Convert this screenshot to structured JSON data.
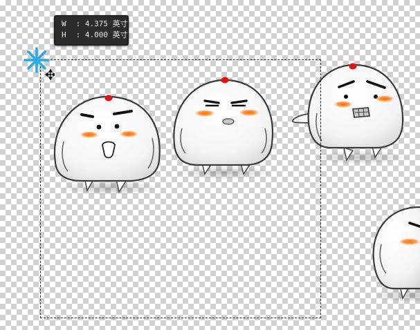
{
  "transform_readout": {
    "width_label": "W",
    "width_value": "4.375",
    "height_label": "H",
    "height_value": "4.000",
    "separator": ":",
    "unit": "英寸"
  },
  "colors": {
    "cursor": "#29a9e6",
    "blush": "#ff7a1a",
    "topknot": "#e0140e",
    "outline": "#333333",
    "tooltip_bg": "#2b2b2b"
  },
  "icons": [
    "asterisk-brush-cursor-icon",
    "move-arrows-icon"
  ]
}
